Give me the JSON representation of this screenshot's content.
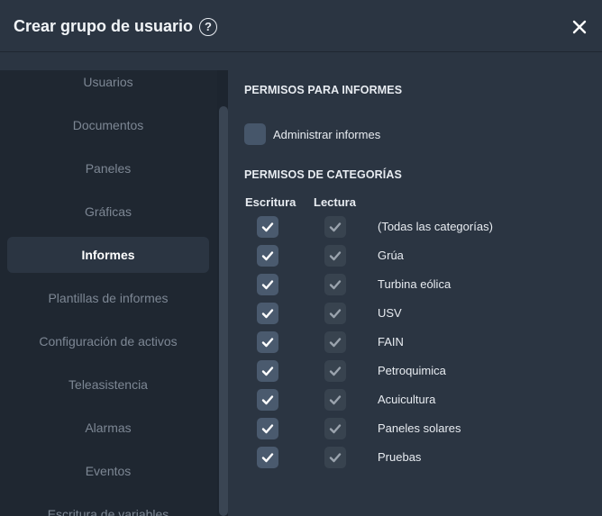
{
  "dialog": {
    "title": "Crear grupo de usuario",
    "help_icon": "question-circle-icon",
    "help_glyph": "?",
    "close_icon": "close-icon"
  },
  "sidebar": {
    "items": [
      {
        "label": "Usuarios",
        "active": false
      },
      {
        "label": "Documentos",
        "active": false
      },
      {
        "label": "Paneles",
        "active": false
      },
      {
        "label": "Gráficas",
        "active": false
      },
      {
        "label": "Informes",
        "active": true
      },
      {
        "label": "Plantillas de informes",
        "active": false
      },
      {
        "label": "Configuración de activos",
        "active": false
      },
      {
        "label": "Teleasistencia",
        "active": false
      },
      {
        "label": "Alarmas",
        "active": false
      },
      {
        "label": "Eventos",
        "active": false
      },
      {
        "label": "Escritura de variables",
        "active": false
      }
    ]
  },
  "reports_permissions": {
    "title": "PERMISOS PARA INFORMES",
    "admin_label": "Administrar informes",
    "admin_checked": false
  },
  "category_permissions": {
    "title": "PERMISOS DE CATEGORÍAS",
    "col_write": "Escritura",
    "col_read": "Lectura",
    "rows": [
      {
        "label": "(Todas las categorías)",
        "write": true,
        "read": true
      },
      {
        "label": "Grúa",
        "write": true,
        "read": true
      },
      {
        "label": "Turbina eólica",
        "write": true,
        "read": true
      },
      {
        "label": "USV",
        "write": true,
        "read": true
      },
      {
        "label": "FAIN",
        "write": true,
        "read": true
      },
      {
        "label": "Petroquimica",
        "write": true,
        "read": true
      },
      {
        "label": "Acuicultura",
        "write": true,
        "read": true
      },
      {
        "label": "Paneles solares",
        "write": true,
        "read": true
      },
      {
        "label": "Pruebas",
        "write": true,
        "read": true
      }
    ]
  },
  "colors": {
    "background": "#2b3542",
    "sidebar": "#1f2731",
    "text": "#e8ecf1",
    "muted_text": "#7d8794",
    "check_write": "#ffffff",
    "check_read": "#9aa3ad"
  }
}
